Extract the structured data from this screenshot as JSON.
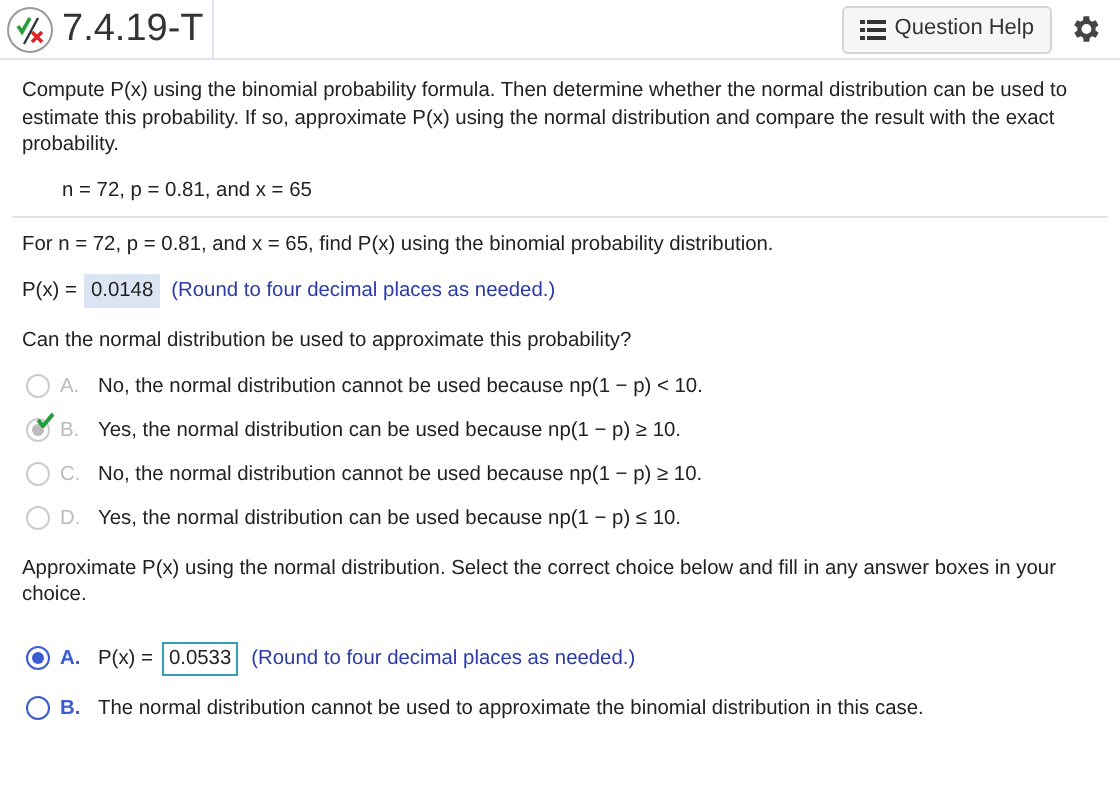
{
  "header": {
    "title": "7.4.19-T",
    "help_button": "Question Help"
  },
  "intro": "Compute P(x) using the binomial probability formula. Then determine whether the normal distribution can be used to estimate this probability. If so, approximate P(x) using the normal distribution and compare the result with the exact probability.",
  "given": "n = 72, p = 0.81, and x = 65",
  "part1": {
    "prompt": "For n = 72, p = 0.81, and x = 65, find P(x) using the binomial probability distribution.",
    "label": "P(x) =",
    "value": "0.0148",
    "hint": "(Round to four decimal places as needed.)"
  },
  "part2": {
    "prompt": "Can the normal distribution be used to approximate this probability?",
    "disabled": true,
    "choices": [
      {
        "letter": "A.",
        "text": "No, the normal distribution cannot be used because np(1 − p) < 10.",
        "selected": false,
        "correct": false
      },
      {
        "letter": "B.",
        "text": "Yes, the normal distribution can be used because np(1 − p) ≥ 10.",
        "selected": true,
        "correct": true
      },
      {
        "letter": "C.",
        "text": "No, the normal distribution cannot be used because np(1 − p) ≥ 10.",
        "selected": false,
        "correct": false
      },
      {
        "letter": "D.",
        "text": "Yes, the normal distribution can be used because np(1 − p) ≤ 10.",
        "selected": false,
        "correct": false
      }
    ]
  },
  "part3": {
    "prompt": "Approximate P(x) using the normal distribution. Select the correct choice below and fill in any answer boxes in your choice.",
    "disabled": false,
    "choices": [
      {
        "kind": "input",
        "letter": "A.",
        "label": "P(x) =",
        "value": "0.0533",
        "hint": "(Round to four decimal places as needed.)",
        "selected": true
      },
      {
        "kind": "text",
        "letter": "B.",
        "text": "The normal distribution cannot be used to approximate the binomial distribution in this case.",
        "selected": false
      }
    ]
  }
}
